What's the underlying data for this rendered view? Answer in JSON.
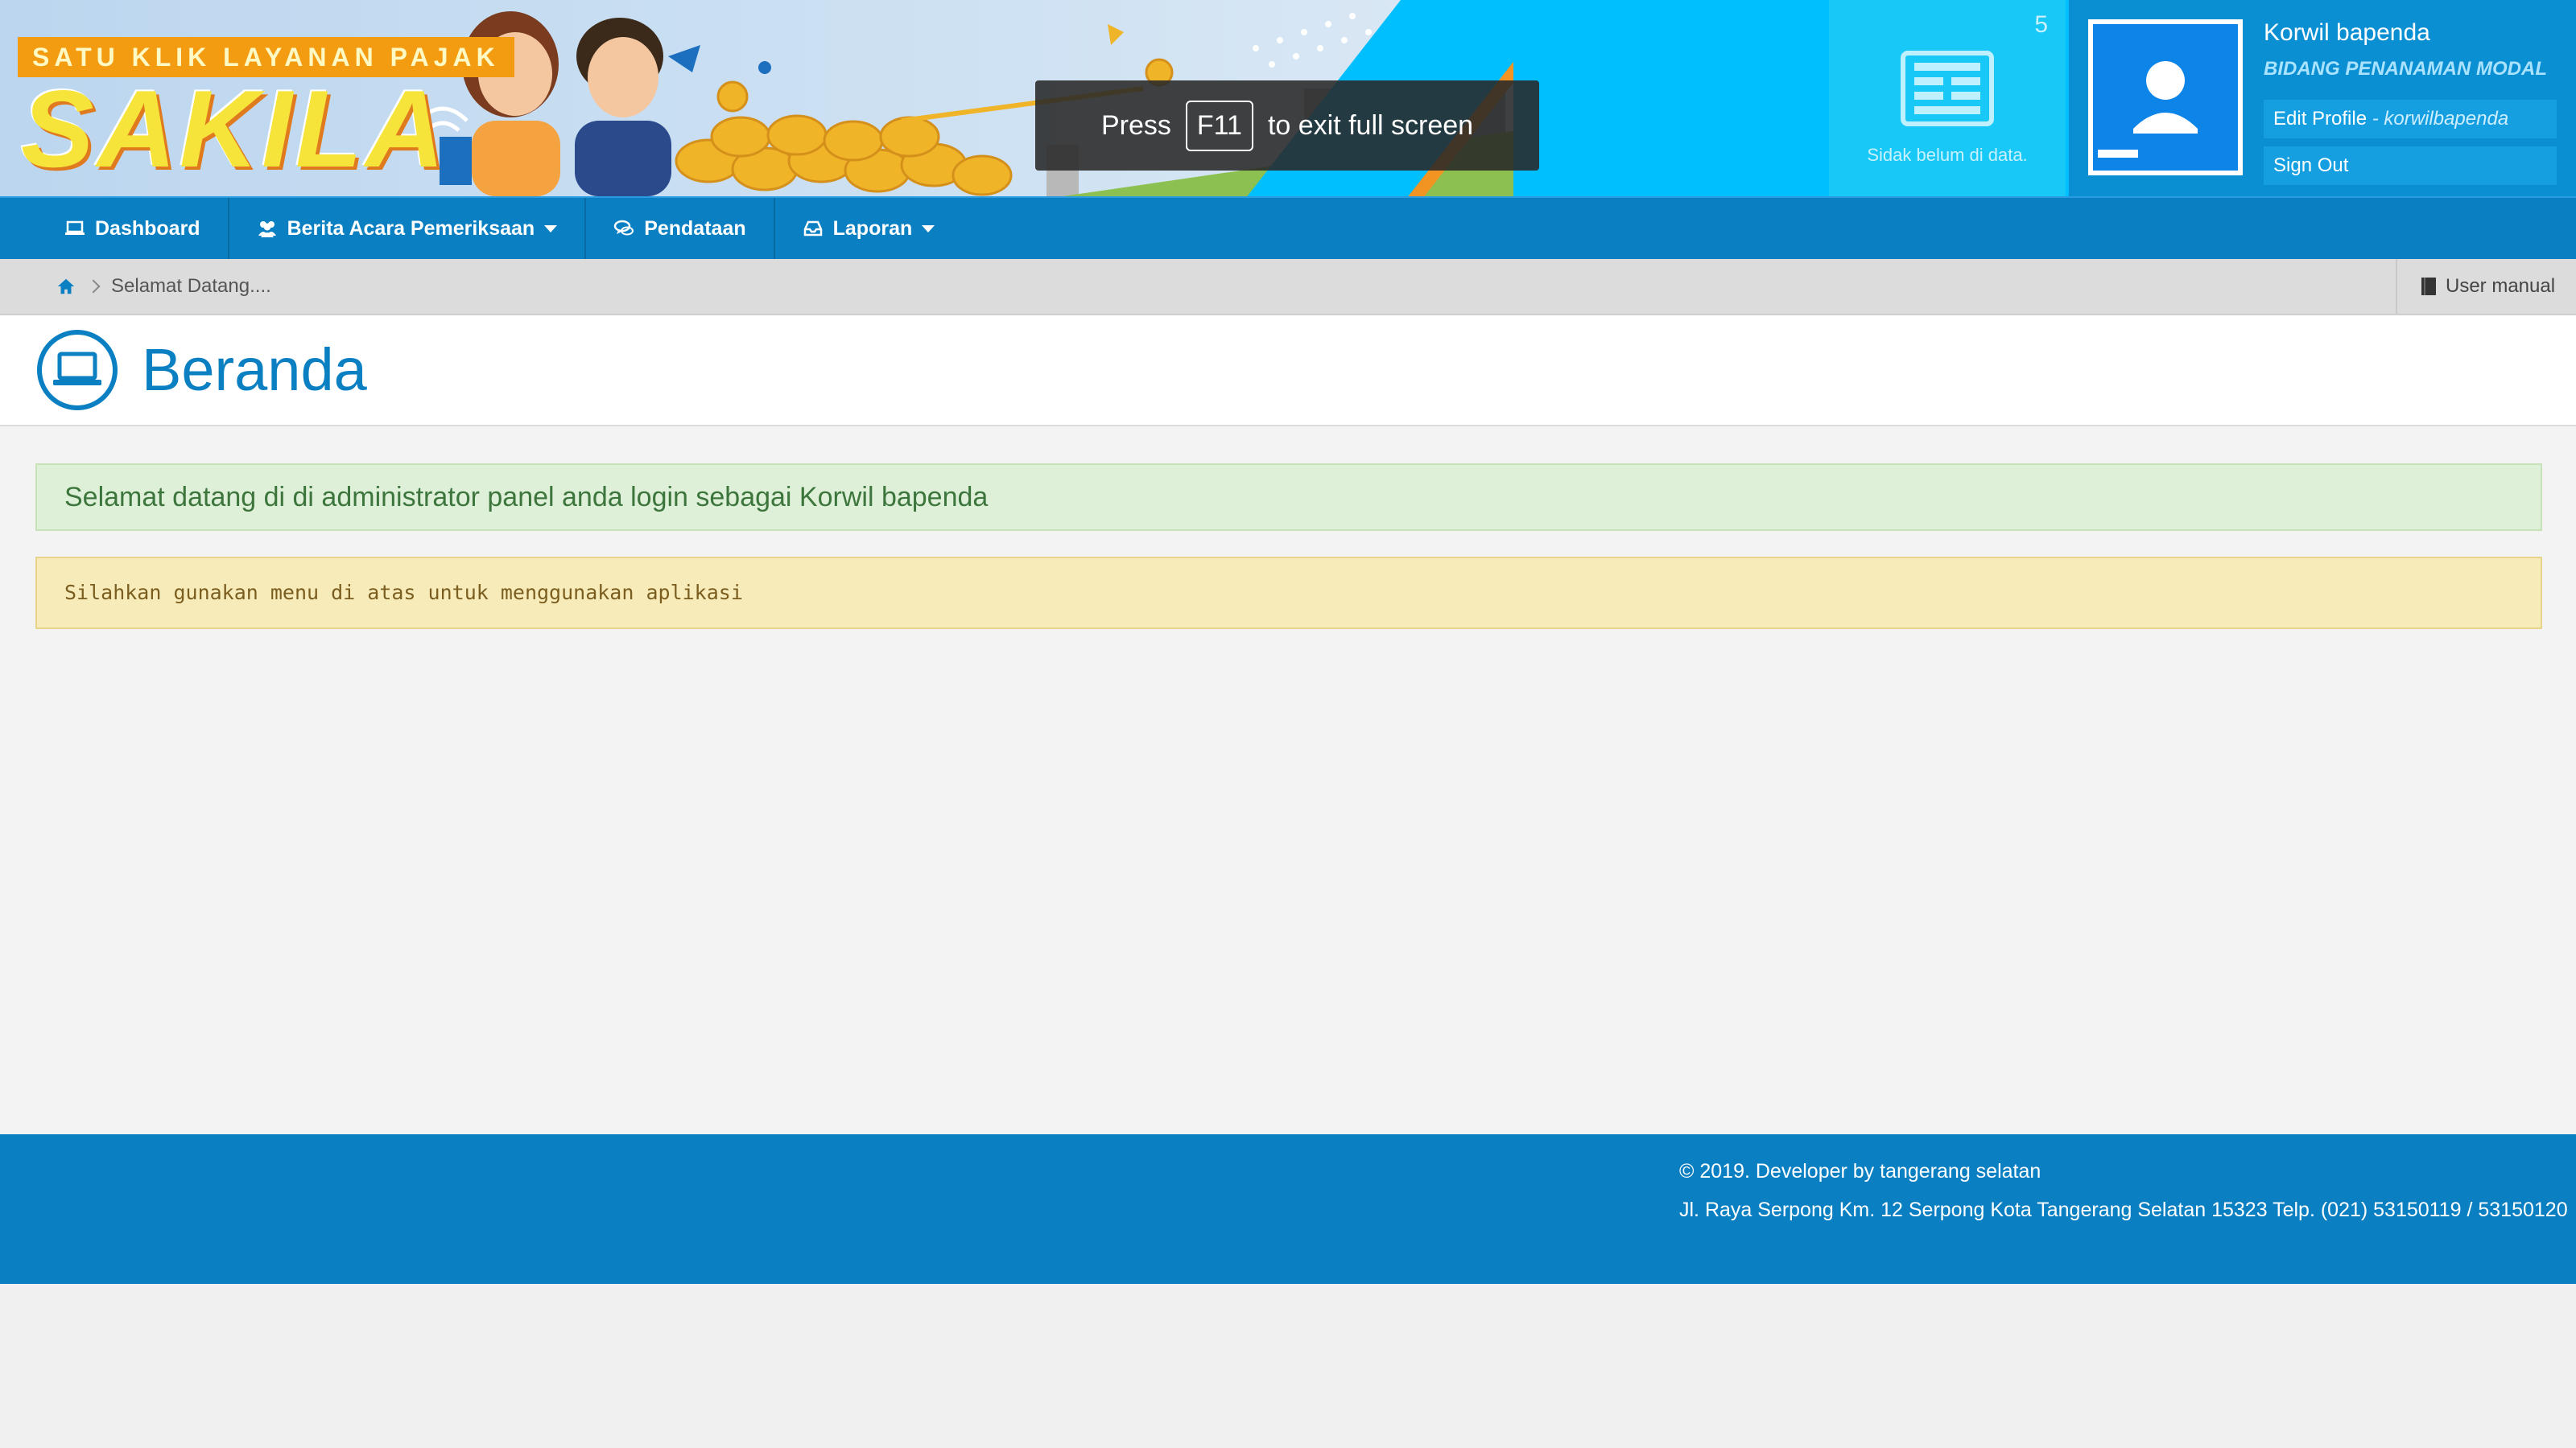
{
  "banner": {
    "tagline": "SATU KLIK LAYANAN PAJAK",
    "logo": "SAKILA"
  },
  "fullscreen_hint": {
    "press": "Press",
    "key": "F11",
    "rest": "to exit full screen"
  },
  "notification": {
    "count": "5",
    "text": "Sidak belum di data."
  },
  "profile": {
    "name": "Korwil bapenda",
    "department": "BIDANG PENANAMAN MODAL",
    "edit_label": "Edit Profile",
    "edit_sub": " - korwilbapenda",
    "signout_label": "Sign Out"
  },
  "nav": {
    "items": [
      {
        "label": "Dashboard"
      },
      {
        "label": "Berita Acara Pemeriksaan"
      },
      {
        "label": "Pendataan"
      },
      {
        "label": "Laporan"
      }
    ]
  },
  "breadcrumb": {
    "current": "Selamat Datang....",
    "user_manual": "User manual"
  },
  "page": {
    "title": "Beranda"
  },
  "alerts": {
    "success": "Selamat datang di di administrator panel anda login sebagai Korwil bapenda",
    "warning": "Silahkan gunakan menu di atas untuk menggunakan aplikasi"
  },
  "footer": {
    "copyright": "© 2019. Developer by tangerang selatan",
    "address": "Jl. Raya Serpong Km. 12 Serpong Kota Tangerang Selatan 15323 Telp. (021) 53150119 / 53150120"
  },
  "colors": {
    "primary": "#0a7fc2",
    "cyan": "#00bfff",
    "success_bg": "#dff0d8",
    "warning_bg": "#f7ecb9"
  }
}
